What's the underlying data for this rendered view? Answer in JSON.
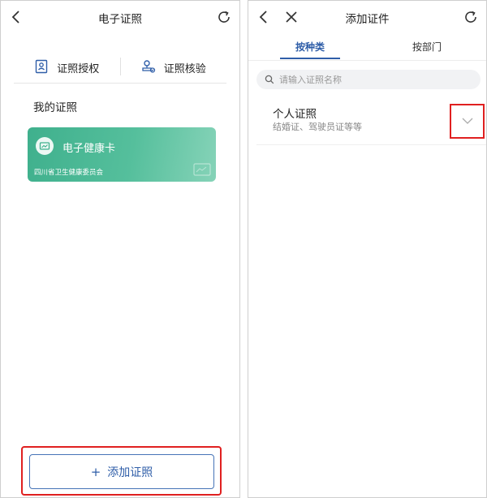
{
  "left": {
    "header": {
      "title": "电子证照"
    },
    "actions": [
      {
        "label": "证照授权",
        "icon": "id-badge-icon"
      },
      {
        "label": "证照核验",
        "icon": "stamp-icon"
      }
    ],
    "section_title": "我的证照",
    "card": {
      "title": "电子健康卡",
      "issuer": "四川省卫生健康委员会",
      "color": "#4fba96"
    },
    "add_button": {
      "label": "添加证照",
      "icon": "plus-icon"
    }
  },
  "right": {
    "header": {
      "title": "添加证件"
    },
    "tabs": [
      {
        "label": "按种类",
        "active": true
      },
      {
        "label": "按部门",
        "active": false
      }
    ],
    "search": {
      "placeholder": "请输入证照名称"
    },
    "category": {
      "title": "个人证照",
      "subtitle": "结婚证、驾驶员证等等"
    }
  },
  "colors": {
    "accent": "#2f5ea8",
    "highlight": "#e02020",
    "card": "#4fba96"
  }
}
